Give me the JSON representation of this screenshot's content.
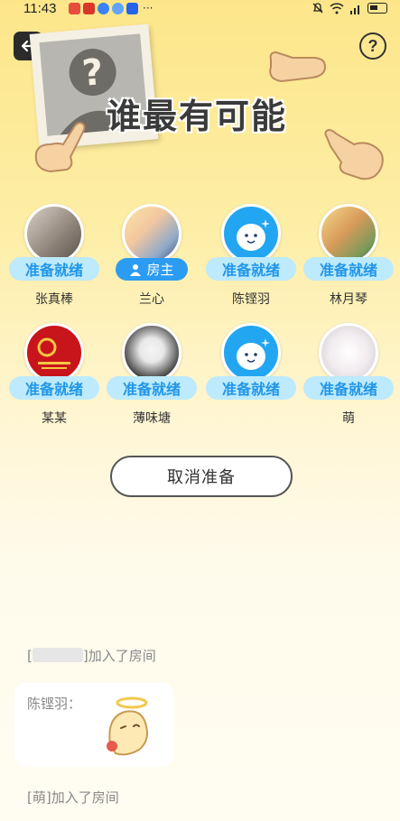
{
  "status_bar": {
    "time": "11:43",
    "dots": "···"
  },
  "header": {
    "title": "谁最有可能",
    "help_label": "?"
  },
  "players": [
    {
      "name": "张真棒",
      "badge": "准备就绪",
      "is_owner": false
    },
    {
      "name": "兰心",
      "badge": "房主",
      "is_owner": true
    },
    {
      "name": "陈铿羽",
      "badge": "准备就绪",
      "is_owner": false
    },
    {
      "name": "林月琴",
      "badge": "准备就绪",
      "is_owner": false
    },
    {
      "name": "某某",
      "badge": "准备就绪",
      "is_owner": false
    },
    {
      "name": "薄味塘",
      "badge": "准备就绪",
      "is_owner": false
    },
    {
      "name": "",
      "badge": "准备就绪",
      "is_owner": false
    },
    {
      "name": "萌",
      "badge": "准备就绪",
      "is_owner": false
    }
  ],
  "cancel_button": "取消准备",
  "chat": {
    "join_msg_1_prefix": "[",
    "join_msg_1_suffix": "]加入了房间",
    "sender": "陈铿羽：",
    "join_msg_2": "[萌]加入了房间"
  },
  "colors": {
    "ready_bg": "#bdeafc",
    "ready_text": "#2196e8",
    "owner_bg": "#2c9cf2"
  }
}
